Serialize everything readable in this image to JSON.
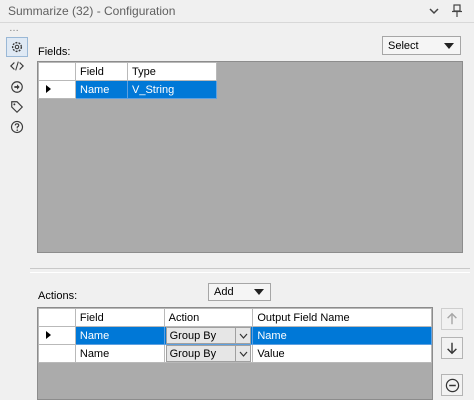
{
  "window": {
    "title": "Summarize (32) - Configuration",
    "overflow_dots": "…"
  },
  "sidebar": {
    "items": [
      {
        "icon": "gear-icon",
        "active": true
      },
      {
        "icon": "code-icon",
        "active": false
      },
      {
        "icon": "rename-icon",
        "active": false
      },
      {
        "icon": "tag-icon",
        "active": false
      },
      {
        "icon": "help-icon",
        "active": false
      }
    ]
  },
  "fields": {
    "label": "Fields:",
    "select_label": "Select",
    "columns": [
      "Field",
      "Type"
    ],
    "rows": [
      {
        "field": "Name",
        "type": "V_String",
        "selected": true
      }
    ]
  },
  "actions": {
    "label": "Actions:",
    "add_label": "Add",
    "columns": [
      "Field",
      "Action",
      "Output Field Name"
    ],
    "rows": [
      {
        "field": "Name",
        "action": "Group By",
        "output": "Name",
        "selected": true
      },
      {
        "field": "Name",
        "action": "Group By",
        "output": "Value",
        "selected": false
      }
    ]
  },
  "colors": {
    "selection": "#0078d7",
    "grid_background": "#ababab",
    "panel_background": "#f0f0f0"
  }
}
